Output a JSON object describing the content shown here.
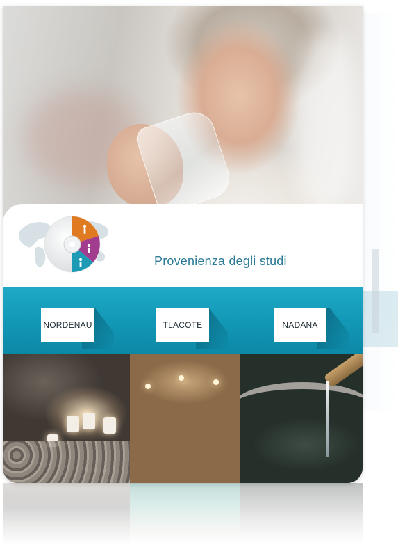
{
  "header": {
    "title": "Provenienza degli studi"
  },
  "locations": [
    {
      "id": "nordenau",
      "label": "NORDENAU"
    },
    {
      "id": "tlacote",
      "label": "TLACOTE"
    },
    {
      "id": "nadana",
      "label": "NADANA"
    }
  ],
  "disc_segments": [
    {
      "color": "#e07a20",
      "icon": "person-icon"
    },
    {
      "color": "#a23c8e",
      "icon": "person-icon"
    },
    {
      "color": "#1d9bb5",
      "icon": "person-icon"
    }
  ],
  "colors": {
    "accent": "#2b7a96",
    "band": "#139ab8"
  }
}
